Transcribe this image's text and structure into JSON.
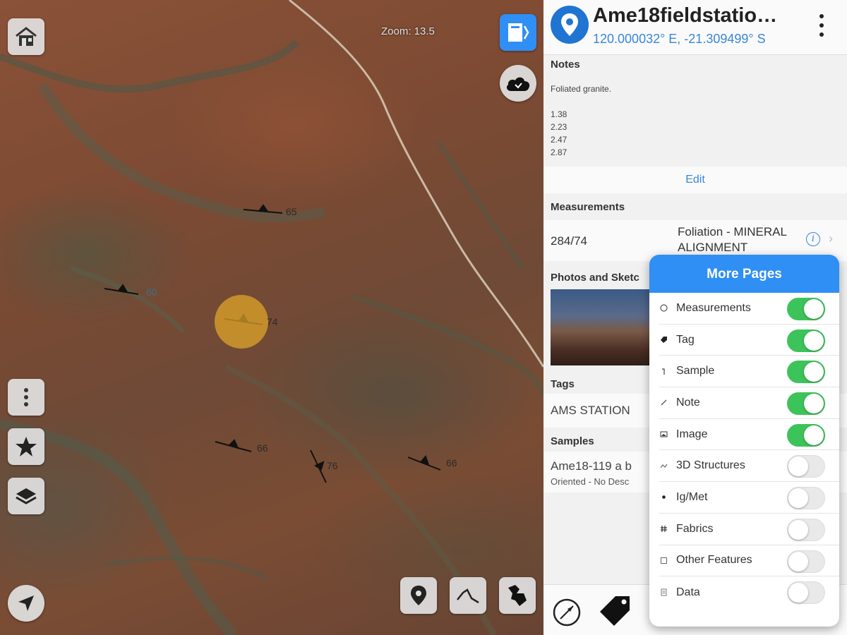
{
  "map": {
    "zoom_label": "Zoom: 13.5",
    "strike_labels": [
      "65",
      "60",
      "74",
      "66",
      "76",
      "66"
    ]
  },
  "spot": {
    "name": "Ame18fieldstatio…",
    "coords": "120.000032° E, -21.309499° S"
  },
  "notes": {
    "title": "Notes",
    "lines": [
      "Foliated granite.",
      "",
      "1.38",
      "2.23",
      "2.47",
      "2.87"
    ],
    "edit_label": "Edit"
  },
  "measurements": {
    "title": "Measurements",
    "value": "284/74",
    "type": "Foliation - MINERAL ALIGNMENT"
  },
  "photos": {
    "title": "Photos and Sketc"
  },
  "tags": {
    "title": "Tags",
    "value": "AMS STATION"
  },
  "samples": {
    "title": "Samples",
    "value": "Ame18-119 a b",
    "sub": "Oriented - No Desc"
  },
  "more_pages": {
    "title": "More Pages",
    "items": [
      {
        "label": "Measurements",
        "icon": "clock-icon",
        "on": true
      },
      {
        "label": "Tag",
        "icon": "tag-icon",
        "on": true
      },
      {
        "label": "Sample",
        "icon": "sample-icon",
        "on": true
      },
      {
        "label": "Note",
        "icon": "note-icon",
        "on": true
      },
      {
        "label": "Image",
        "icon": "image-icon",
        "on": true
      },
      {
        "label": "3D Structures",
        "icon": "3d-structures-icon",
        "on": false
      },
      {
        "label": "Ig/Met",
        "icon": "ig-met-icon",
        "on": false
      },
      {
        "label": "Fabrics",
        "icon": "fabrics-icon",
        "on": false
      },
      {
        "label": "Other Features",
        "icon": "other-features-icon",
        "on": false
      },
      {
        "label": "Data",
        "icon": "data-icon",
        "on": false
      }
    ]
  },
  "colors": {
    "accent_blue": "#2f8ff5",
    "toggle_on": "#3cc35a",
    "link_blue": "#3a86d8"
  }
}
